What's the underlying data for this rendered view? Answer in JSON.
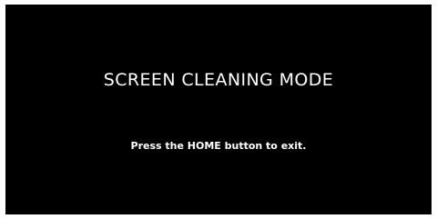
{
  "screen": {
    "title": "SCREEN CLEANING MODE",
    "instruction": "Press the HOME button to exit.",
    "background_color": "#000000",
    "text_color": "#ffffff"
  }
}
